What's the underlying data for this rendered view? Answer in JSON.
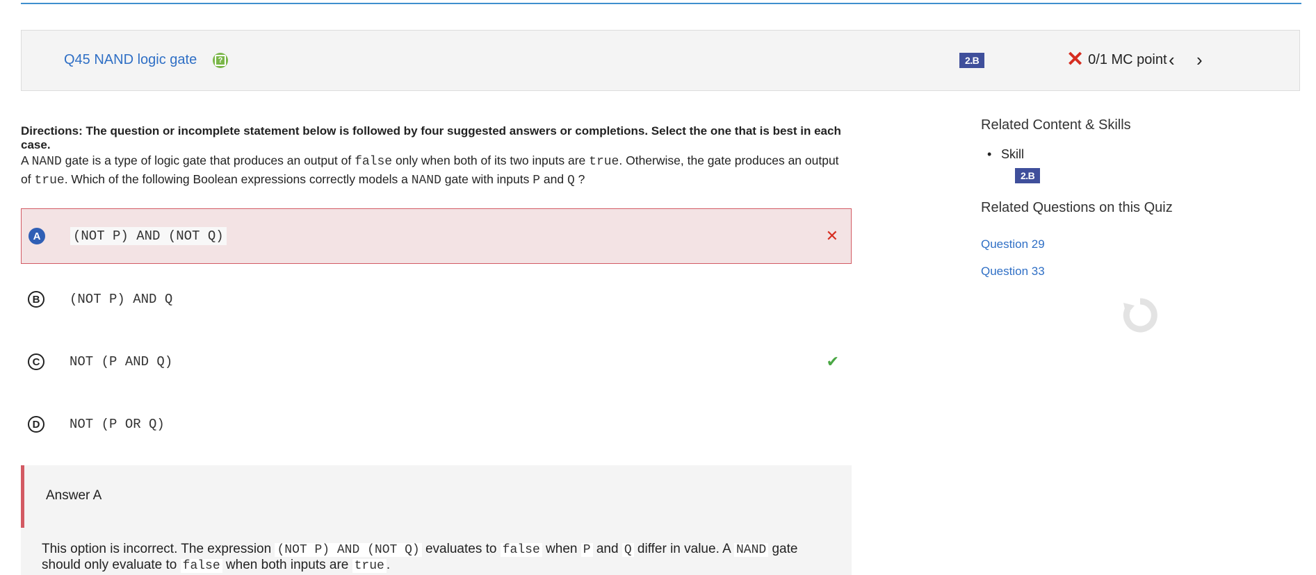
{
  "header": {
    "title": "Q45 NAND logic gate",
    "skill_badge": "2.B",
    "score": "0/1 MC point"
  },
  "directions": "Directions: The question or incomplete statement below is followed by four suggested answers or completions. Select the one that is best in each case.",
  "stem": {
    "t1": "A ",
    "c1": "NAND",
    "t2": " gate is a type of logic gate that produces an output of ",
    "c2": "false",
    "t3": " only when both of its two inputs are ",
    "c3": "true",
    "t4": ". Otherwise, the gate produces an output of ",
    "c4": "true",
    "t5": ". Which of the following Boolean expressions correctly models a ",
    "c5": "NAND",
    "t6": " gate with inputs ",
    "c6": "P",
    "t7": " and ",
    "c7": "Q",
    "t8": " ?"
  },
  "choices": [
    {
      "letter": "A",
      "text": "(NOT P) AND (NOT Q)",
      "state": "selected-incorrect"
    },
    {
      "letter": "B",
      "text": "(NOT P) AND Q",
      "state": "none"
    },
    {
      "letter": "C",
      "text": "NOT (P AND Q)",
      "state": "correct"
    },
    {
      "letter": "D",
      "text": "NOT (P OR Q)",
      "state": "none"
    }
  ],
  "explanation": {
    "title": "Answer A",
    "t1": "This option is incorrect. The expression ",
    "c1": "(NOT P) AND (NOT Q)",
    "t2": " evaluates to ",
    "c2": "false",
    "t3": " when ",
    "c3": "P",
    "t4": " and ",
    "c4": "Q",
    "t5": " differ in value. A ",
    "c5": "NAND",
    "t6": " gate should only evaluate to ",
    "c6": "false",
    "t7": " when both inputs are ",
    "c7": "true",
    "t8": "."
  },
  "sidebar": {
    "related_heading": "Related Content & Skills",
    "skill_label": "Skill",
    "skill_badge": "2.B",
    "questions_heading": "Related Questions on this Quiz",
    "links": [
      "Question 29",
      "Question 33"
    ]
  },
  "colors": {
    "link": "#2f6fc5",
    "badge": "#3f4f9b",
    "incorrect": "#d62d20",
    "correct": "#4aa744",
    "help_icon": "#7ab648"
  },
  "icons": [
    "help-icon",
    "x-icon",
    "chevron-left-icon",
    "chevron-right-icon",
    "times-icon",
    "check-icon",
    "reload-icon"
  ]
}
